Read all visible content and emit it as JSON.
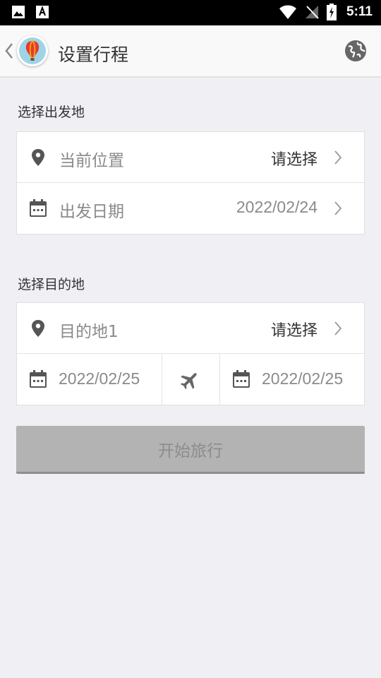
{
  "status_bar": {
    "time": "5:11"
  },
  "app_bar": {
    "title": "设置行程"
  },
  "departure": {
    "section_label": "选择出发地",
    "location_label": "当前位置",
    "location_value": "请选择",
    "date_label": "出发日期",
    "date_value": "2022/02/24"
  },
  "destination": {
    "section_label": "选择目的地",
    "dest_label": "目的地1",
    "dest_value": "请选择",
    "start_date": "2022/02/25",
    "end_date": "2022/02/25"
  },
  "start_button": {
    "label": "开始旅行"
  },
  "icons": {
    "back": "chevron-left-icon",
    "logo": "hot-air-balloon-icon",
    "globe": "globe-icon",
    "location": "location-pin-icon",
    "calendar": "calendar-icon",
    "chevron": "chevron-right-icon",
    "plane": "airplane-icon"
  },
  "colors": {
    "background": "#efeff4",
    "status_bar": "#000000",
    "button_disabled": "#b3b3b3",
    "text_primary": "#333333",
    "text_muted": "#8a8a8a"
  }
}
